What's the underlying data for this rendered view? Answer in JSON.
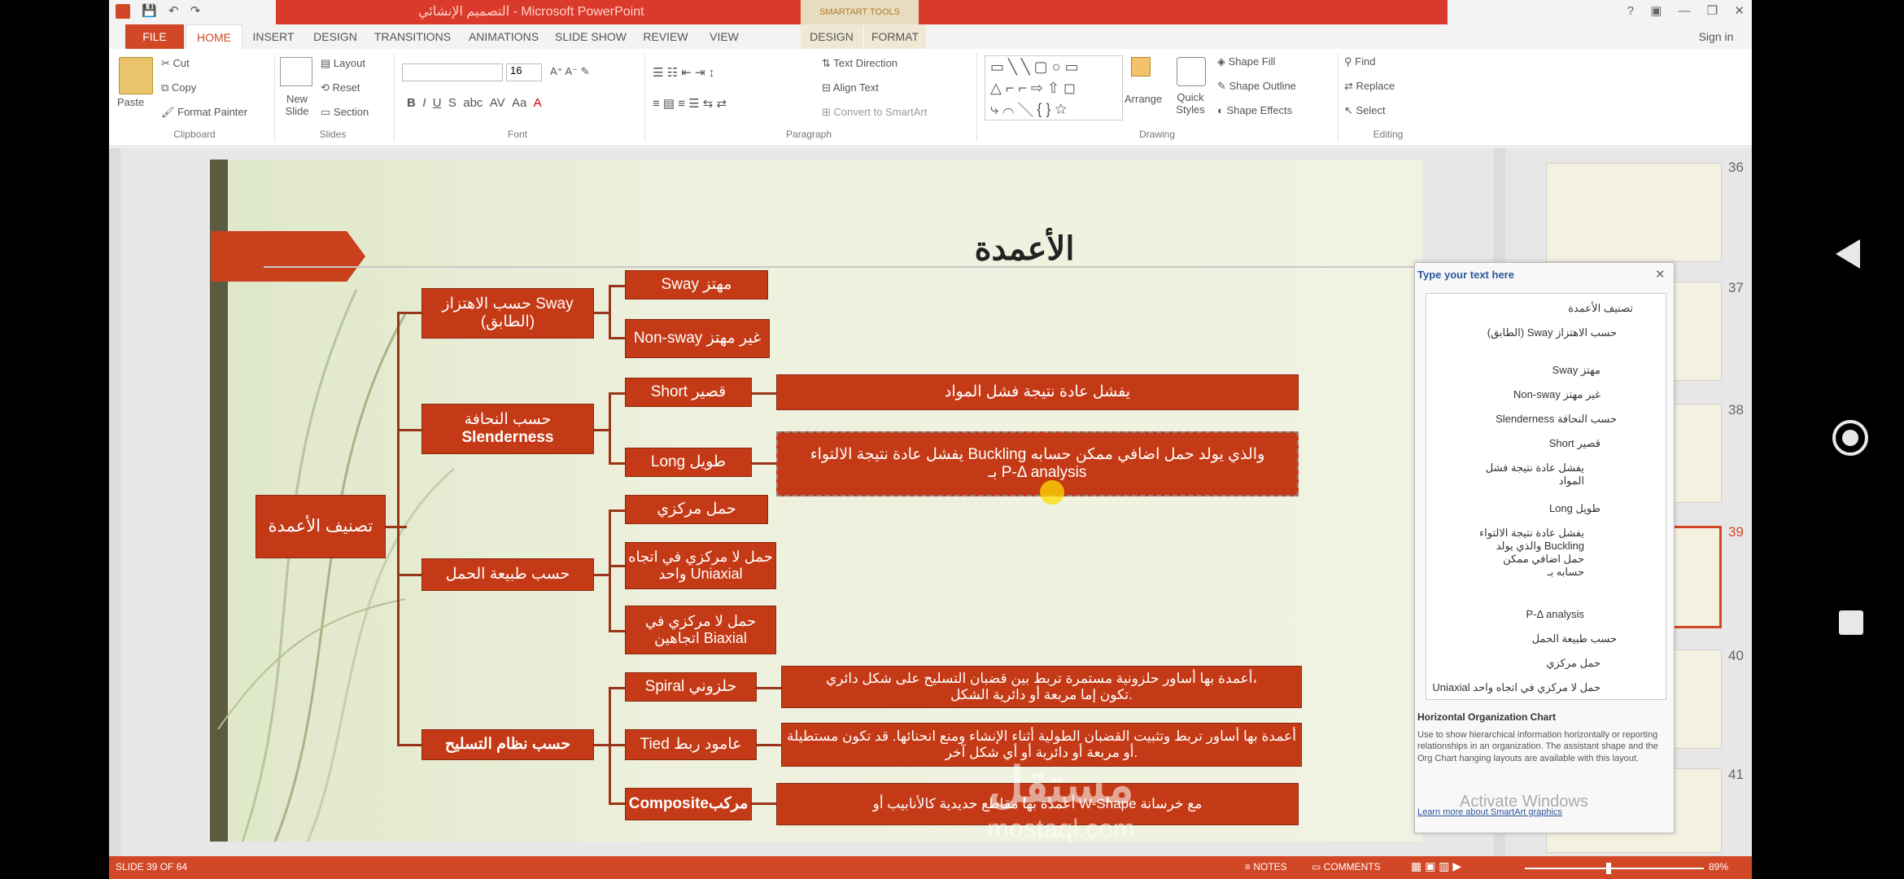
{
  "window": {
    "title": "التصميم الإنشائي - Microsoft PowerPoint",
    "smartart_tools": "SMARTART TOOLS",
    "signin": "Sign in"
  },
  "tabs": [
    "FILE",
    "HOME",
    "INSERT",
    "DESIGN",
    "TRANSITIONS",
    "ANIMATIONS",
    "SLIDE SHOW",
    "REVIEW",
    "VIEW",
    "DESIGN",
    "FORMAT"
  ],
  "ribbon": {
    "clipboard": {
      "paste": "Paste",
      "cut": "Cut",
      "copy": "Copy",
      "format_painter": "Format Painter",
      "label": "Clipboard"
    },
    "slides": {
      "new_slide": "New Slide",
      "layout": "Layout",
      "reset": "Reset",
      "section": "Section",
      "label": "Slides"
    },
    "font": {
      "font_name": "",
      "font_size": "16",
      "label": "Font"
    },
    "paragraph": {
      "text_direction": "Text Direction",
      "align_text": "Align Text",
      "convert": "Convert to SmartArt",
      "label": "Paragraph"
    },
    "drawing": {
      "arrange": "Arrange",
      "quick_styles": "Quick Styles",
      "shape_fill": "Shape Fill",
      "shape_outline": "Shape Outline",
      "shape_effects": "Shape Effects",
      "label": "Drawing"
    },
    "editing": {
      "find": "Find",
      "replace": "Replace",
      "select": "Select",
      "label": "Editing"
    }
  },
  "slide": {
    "title": "الأعمدة",
    "root": "تصنيف الأعمدة",
    "categories": {
      "sway": "حسب الاهتزاز Sway (الطابق)",
      "slenderness_ar": "حسب النحافة",
      "slenderness_en": "Slenderness",
      "load": "حسب طبيعة الحمل",
      "reinforcement": "حسب نظام التسليح"
    },
    "items": {
      "sway": "Sway مهتز",
      "nonsway": "Non-sway غير مهتز",
      "short": "Short قصير",
      "long": "Long طويل",
      "concentric": "حمل مركزي",
      "uniaxial": "حمل لا مركزي في اتجاه واحد Uniaxial",
      "biaxial": "حمل لا مركزي في اتجاهين Biaxial",
      "spiral": "Spiral حلزوني",
      "tied": "Tied عامود ربط",
      "composite": "Compositeمركب"
    },
    "details": {
      "short": "يفشل عادة نتيجة فشل المواد",
      "long_1": "يفشل عادة نتيجة الالتواء Buckling والذي يولد حمل اضافي ممكن حسابه",
      "long_2": "بـ P-Δ analysis",
      "spiral_1": "أعمدة بها أساور حلزونية مستمرة تربط بين قضبان التسليح على شكل دائري،",
      "spiral_2": "تكون إما مربعة أو دائرية الشكل.",
      "tied_1": "أعمدة بها أساور تربط وتثبيت القضبان الطولية أثناء الإنشاء ومنع انحنائها. قد تكون مستطيلة",
      "tied_2": "أو مربعة أو دائرية أو أي شكل آخر.",
      "composite": "أعمدة بها مقاطع حديدية كالأنابيب أو W-Shape مع خرسانة"
    }
  },
  "text_pane": {
    "title": "Type your text here",
    "items": [
      "تصنيف الأعمدة",
      "حسب الاهتزاز Sway (الطابق)",
      "مهتز Sway",
      "غير مهتز Non-sway",
      "حسب النحافة Slenderness",
      "قصير Short",
      "يفشل عادة نتيجة فشل المواد",
      "طويل Long",
      "يفشل عادة نتيجة الالتواء Buckling والذي يولد حمل اضافي ممكن حسابه بـ",
      "P-Δ analysis",
      "حسب طبيعة الحمل",
      "حمل مركزي",
      "حمل لا مركزي في اتجاه واحد Uniaxial"
    ],
    "desc_title": "Horizontal Organization Chart",
    "desc_text": "Use to show hierarchical information horizontally or reporting relationships in an organization. The assistant shape and the Org Chart hanging layouts are available with this layout.",
    "learn_more": "Learn more about SmartArt graphics",
    "activate": "Activate Windows"
  },
  "thumbnails": [
    "36",
    "37",
    "38",
    "39",
    "40",
    "41"
  ],
  "statusbar": {
    "slide_info": "SLIDE 39 OF 64",
    "notes": "NOTES",
    "comments": "COMMENTS",
    "zoom": "89%"
  },
  "watermark": {
    "main": "مستقل",
    "sub": "mostaql.com"
  },
  "colors": {
    "accent": "#d24726",
    "box": "#c43a16",
    "title_red": "#d93a2b"
  }
}
